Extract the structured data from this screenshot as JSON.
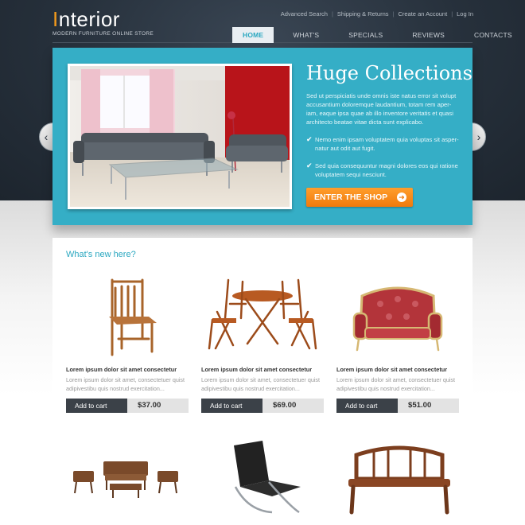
{
  "header": {
    "logo_first": "I",
    "logo_rest": "nterior",
    "tagline": "MODERN FURNITURE ONLINE STORE",
    "util_links": [
      "Advanced Search",
      "Shipping & Returns",
      "Create an Account",
      "Log In"
    ],
    "nav": [
      "HOME",
      "WHAT'S NEW",
      "SPECIALS",
      "REVIEWS",
      "CONTACTS"
    ],
    "active_nav": "HOME"
  },
  "slider": {
    "title": "Huge Collections",
    "text": "Sed ut perspiciatis unde omnis iste natus error sit volupt accusantium doloremque laudantium, totam rem aper-iam, eaque ipsa quae ab illo inventore veritatis et quasi architecto beatae vitae dicta sunt explicabo.",
    "bullet_1": "Nemo enim ipsam voluptatem quia voluptas sit asper-natur aut odit aut fugit.",
    "bullet_2": "Sed quia consequuntur magni dolores eos qui ratione voluptatem sequi nesciunt.",
    "cta": "ENTER THE SHOP",
    "arrow_left": "‹",
    "arrow_right": "›",
    "accent_color": "#35aec6",
    "button_color": "#f58a16"
  },
  "whats_new": {
    "title": "What's new here?",
    "products": [
      {
        "name": "Lorem ipsum dolor sit amet consectetur",
        "desc": "Lorem ipsum dolor sit amet, consectetuer quist adipivestibu quis nostrud exercitation...",
        "cart": "Add to cart",
        "price": "$37.00",
        "image": "wooden-chair"
      },
      {
        "name": "Lorem ipsum dolor sit amet consectetur",
        "desc": "Lorem ipsum dolor sit amet, consectetuer quist adipivestibu quis nostrud exercitation...",
        "cart": "Add to cart",
        "price": "$69.00",
        "image": "patio-dining-set"
      },
      {
        "name": "Lorem ipsum dolor sit amet consectetur",
        "desc": "Lorem ipsum dolor sit amet, consectetuer quist adipivestibu quis nostrud exercitation...",
        "cart": "Add to cart",
        "price": "$51.00",
        "image": "red-loveseat"
      }
    ]
  },
  "bottom_row": [
    "outdoor-lounge-set",
    "black-leather-chair",
    "wooden-bench"
  ]
}
